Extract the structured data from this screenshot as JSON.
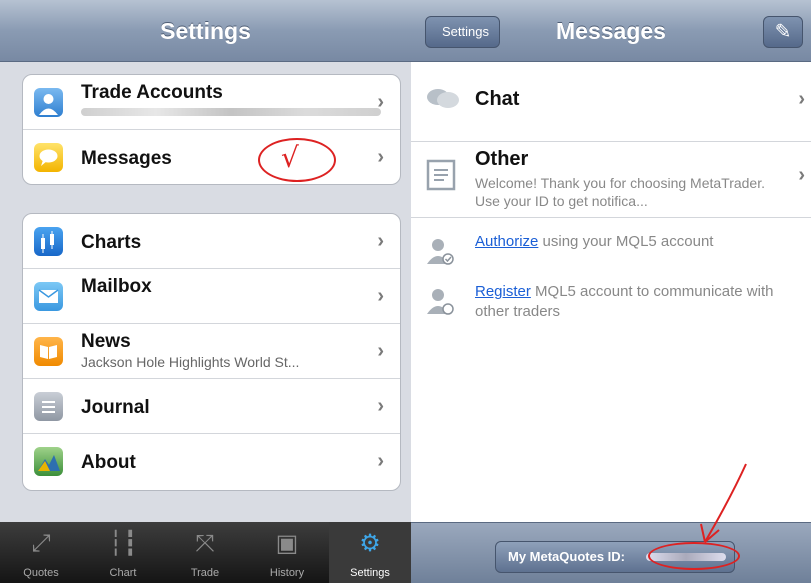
{
  "left": {
    "title": "Settings",
    "group1": [
      {
        "label": "Trade Accounts",
        "icon": "user-icon"
      },
      {
        "label": "Messages",
        "icon": "message-icon"
      }
    ],
    "group2": [
      {
        "label": "Charts",
        "sub": "",
        "icon": "charts-icon"
      },
      {
        "label": "Mailbox",
        "sub": "",
        "icon": "mail-icon"
      },
      {
        "label": "News",
        "sub": "Jackson Hole Highlights World St...",
        "icon": "news-icon"
      },
      {
        "label": "Journal",
        "sub": "",
        "icon": "journal-icon"
      },
      {
        "label": "About",
        "sub": "",
        "icon": "about-icon"
      }
    ],
    "annotation": "√"
  },
  "tabs": [
    {
      "label": "Quotes",
      "icon": "quotes-icon"
    },
    {
      "label": "Chart",
      "icon": "chart-icon"
    },
    {
      "label": "Trade",
      "icon": "trade-icon"
    },
    {
      "label": "History",
      "icon": "history-icon"
    },
    {
      "label": "Settings",
      "icon": "settings-icon",
      "active": true
    }
  ],
  "right": {
    "back": "Settings",
    "title": "Messages",
    "rows": [
      {
        "label": "Chat",
        "icon": "chat-icon"
      },
      {
        "label": "Other",
        "sub": "Welcome! Thank you for choosing MetaTrader. Use your ID to get notifica...",
        "icon": "document-icon"
      }
    ],
    "authorize": {
      "link": "Authorize",
      "text": " using your MQL5 account"
    },
    "register": {
      "link": "Register",
      "text": " MQL5 account to communicate with other traders"
    },
    "bottom_button": "My MetaQuotes ID:"
  }
}
